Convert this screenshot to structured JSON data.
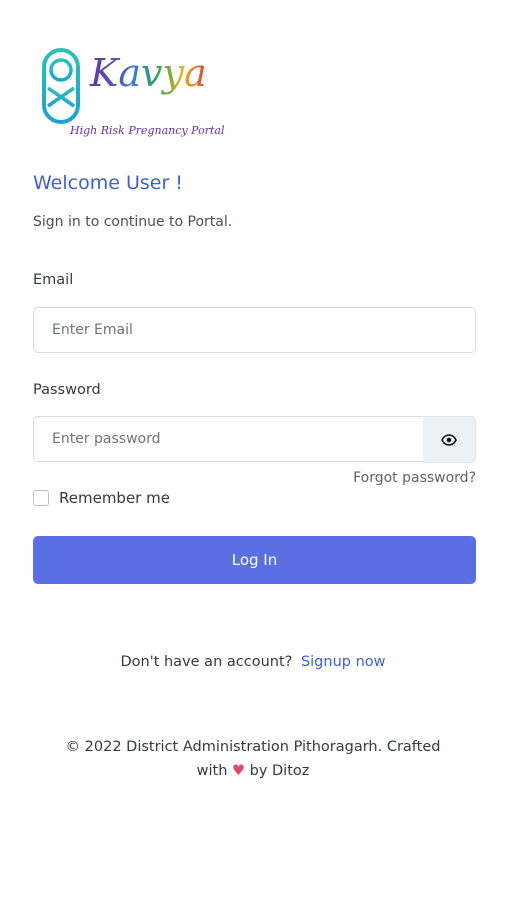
{
  "brand": {
    "name": "Kavya",
    "tagline": "High Risk Pregnancy Portal"
  },
  "welcome": {
    "title": "Welcome User !",
    "subtitle": "Sign in to continue to Portal."
  },
  "form": {
    "email_label": "Email",
    "email_placeholder": "Enter Email",
    "email_value": "",
    "password_label": "Password",
    "password_placeholder": "Enter password",
    "password_value": "",
    "toggle_icon": "eye-icon",
    "forgot_label": "Forgot password?",
    "remember_label": "Remember me",
    "remember_checked": false,
    "login_label": "Log In"
  },
  "signup": {
    "prompt": "Don't have an account?",
    "link_label": "Signup now"
  },
  "footer": {
    "line1": "© 2022 District Administration Pithoragarh. Crafted",
    "with": "with",
    "heart": "♥",
    "by": "by Ditoz"
  },
  "colors": {
    "primary": "#5a6fe3",
    "link": "#3d5ee1",
    "heart": "#e5485c"
  }
}
